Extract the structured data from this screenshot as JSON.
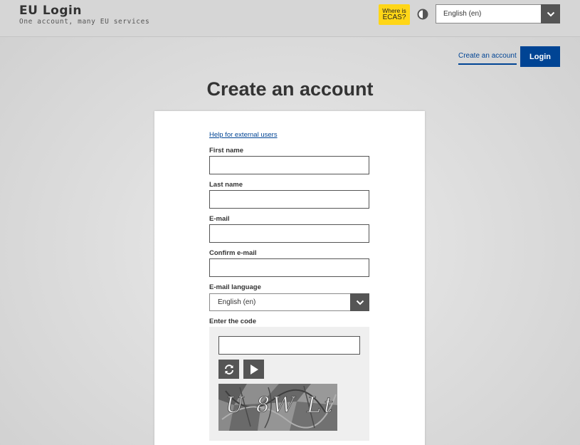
{
  "header": {
    "title": "EU Login",
    "subtitle": "One account, many EU services",
    "ecas_line1": "Where is",
    "ecas_line2": "ECAS?",
    "language": "English (en)",
    "icons": [
      "contrast-icon",
      "chevron-down-icon"
    ]
  },
  "nav": {
    "create_account": "Create an account",
    "login": "Login"
  },
  "page": {
    "title": "Create an account"
  },
  "form": {
    "help_link": "Help for external users",
    "first_name_label": "First name",
    "first_name_value": "",
    "last_name_label": "Last name",
    "last_name_value": "",
    "email_label": "E-mail",
    "email_value": "",
    "confirm_email_label": "Confirm e-mail",
    "confirm_email_value": "",
    "email_language_label": "E-mail language",
    "email_language_value": "English (en)",
    "code_label": "Enter the code",
    "code_value": "",
    "captcha_text": "U 8W Lt",
    "icons": [
      "refresh-icon",
      "play-icon"
    ]
  },
  "colors": {
    "primary": "#004494",
    "ecas_yellow": "#ffd617",
    "dark_grey": "#555555"
  }
}
